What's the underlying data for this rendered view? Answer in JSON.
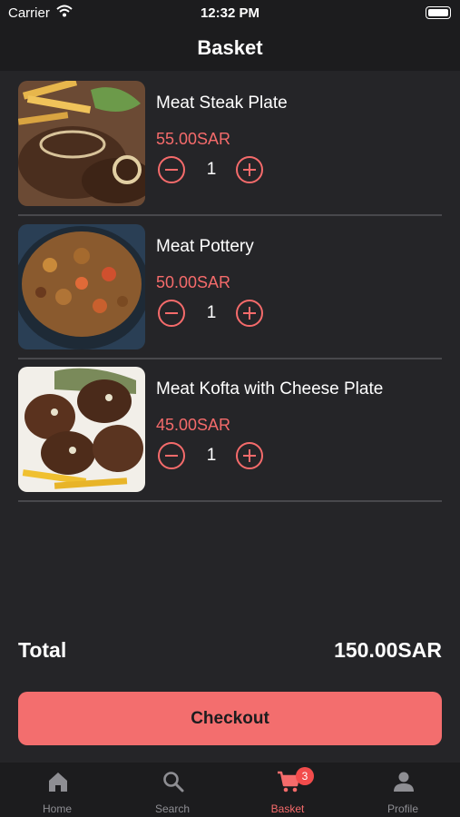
{
  "status_bar": {
    "carrier": "Carrier",
    "time": "12:32 PM"
  },
  "nav": {
    "title": "Basket"
  },
  "items": [
    {
      "name": "Meat Steak Plate",
      "price": "55.00SAR",
      "quantity": "1"
    },
    {
      "name": "Meat Pottery",
      "price": "50.00SAR",
      "quantity": "1"
    },
    {
      "name": "Meat Kofta with Cheese Plate",
      "price": "45.00SAR",
      "quantity": "1"
    }
  ],
  "summary": {
    "total_label": "Total",
    "total_value": "150.00SAR"
  },
  "checkout": {
    "label": "Checkout"
  },
  "tabs": [
    {
      "label": "Home",
      "icon": "home-icon"
    },
    {
      "label": "Search",
      "icon": "search-icon"
    },
    {
      "label": "Basket",
      "icon": "cart-icon",
      "badge": "3"
    },
    {
      "label": "Profile",
      "icon": "person-icon"
    }
  ],
  "colors": {
    "accent": "#f56b6b",
    "background": "#252528",
    "bar": "#1c1c1e"
  }
}
